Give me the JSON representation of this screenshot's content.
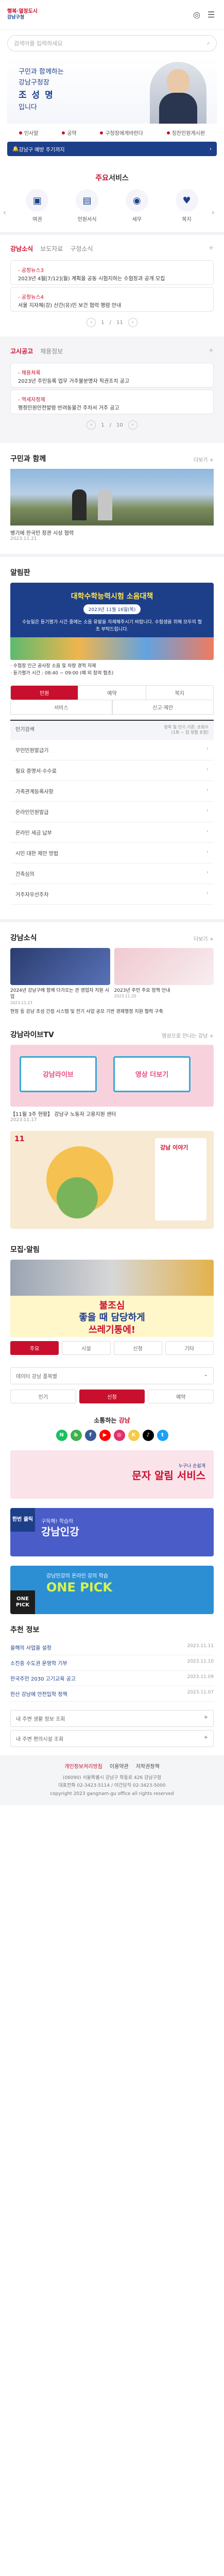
{
  "header": {
    "logo_line1": "행복·열정도시",
    "logo_line2": "강남구청",
    "menu_icon": "hamburger-icon",
    "lang_icon": "globe-icon"
  },
  "search": {
    "placeholder": "검색어를 입력하세요",
    "icon": "search-icon"
  },
  "hero": {
    "line1": "구민과 함께하는",
    "line2": "강남구청장",
    "name": "조 성 명",
    "line3": "입니다"
  },
  "hero_links": [
    "인사말",
    "공약",
    "구청장에게바란다",
    "칭찬민원게시판"
  ],
  "notice": {
    "label": "강남구 예방 주기까지",
    "arrow": "›"
  },
  "services": {
    "title_pre": "주요",
    "title_accent": "서비스",
    "items": [
      {
        "label": "여권"
      },
      {
        "label": "민원서식"
      },
      {
        "label": "세무"
      },
      {
        "label": "복지"
      }
    ]
  },
  "news": {
    "tabs": [
      "강남소식",
      "보도자료",
      "구정소식"
    ],
    "more": "+",
    "cards": [
      {
        "cat": "- 공정뉴스3",
        "title": "2023년 4월[7/12](월) 계획을 공동 시험지하는 수험장과 공개 모집",
        "date": "2023.11.27"
      },
      {
        "cat": "- 공정뉴스4",
        "title": "서울 지자체(강) 산간(유)민 보건 협력 행령 안내",
        "date": "2023.10.03"
      }
    ],
    "pager": {
      "current": "1",
      "total": "11"
    }
  },
  "notice_board": {
    "tabs": [
      "고시공고",
      "채용정보"
    ],
    "more": "+",
    "cards": [
      {
        "cat": "- 채용쳐록",
        "title": "2023년 주민등록 업무 거주불분명자 직권조치 공고",
        "date": "2023.11.07"
      },
      {
        "cat": "- 역세자정제",
        "title": "행정민원안전발령 반려동물건 주차서 거주 공고",
        "date": "2023.11.07"
      }
    ],
    "pager": {
      "current": "1",
      "total": "10"
    }
  },
  "mayor_with": {
    "title": "구민과 함께",
    "more": "더보기 +",
    "caption": "뱅기에 한국민 장관 시상 협력",
    "date": "2023.11.21"
  },
  "alert": {
    "title": "알림판",
    "banner_title": "대학수학능력시험 소음대책",
    "banner_date": "2023년 11월 16일(목)",
    "banner_body": "수능일은 듣기평가 시간 중에는 소음 유발을 자제해주시기 바랍니다. 수험생을 위해 모두의 협조 부탁드립니다.",
    "desc": "· 수험장 인근 공사장 소음 및 차량 경적 자제\n· 듣기평가 시간 : 08:40 ~ 09:00 (예 외 참여 협조)"
  },
  "popular": {
    "tabs": [
      "민원",
      "예약",
      "복지"
    ],
    "tabs2": [
      "서비스",
      "신고·제안"
    ],
    "head_label": "인기검색",
    "head_note": "항목 및 인기 기준: 조회수\n(1회 ~ 집 정렬 포함)",
    "rows": [
      {
        "label": "무인민원발급기",
        "arrow": "›"
      },
      {
        "label": "필요 증명서·수수료",
        "arrow": "›"
      },
      {
        "label": "가족관계등록사항",
        "arrow": "›"
      },
      {
        "label": "온라인민원발급",
        "arrow": "›"
      },
      {
        "label": "온라인 세금 납부",
        "arrow": "›"
      },
      {
        "label": "시민 대한 제안 방법",
        "arrow": "›"
      },
      {
        "label": "건축심의",
        "arrow": "›"
      },
      {
        "label": "거주자우선주차",
        "arrow": "›"
      }
    ]
  },
  "gangnam_news": {
    "title": "강남소식",
    "more": "더보기 +",
    "items": [
      {
        "title": "2024년 강남구에 함께 다가오는 관 영업자 지원 사업",
        "date": "2023.11.23"
      },
      {
        "title": "2023년 주민 주요 정책 안내",
        "date": "2023.11.20"
      }
    ],
    "extra": "현장 등 강남 조성 간접 시스템 및 전기 사업 공모 기반 경제행정 지원 협력 구축"
  },
  "tv": {
    "title": "강남라이브TV",
    "more": "영상으로 만나는 강남 +",
    "box_left": "강남라이브",
    "box_right": "영상 더보기",
    "desc": "【11월 3주 현황】 강남구 노동자 고용지원 센터",
    "date": "2023.11.17"
  },
  "poster": {
    "page": "11",
    "side": "강남 이야기"
  },
  "mojip": {
    "title": "모집·알림",
    "line1": "불조심",
    "line2": "좋을 때 담당하게",
    "line3": "쓰레기통에!"
  },
  "mojip_tabs": [
    "주요",
    "시설",
    "신청",
    "기타"
  ],
  "data_bar": {
    "title": "데이터 강남 품목별",
    "icon": "chevron-down-icon"
  },
  "small_tabs": [
    "인기",
    "신청",
    "예약"
  ],
  "sns": {
    "title_pre": "소통하는",
    "title_accent": "강남",
    "items": [
      {
        "t": "N",
        "c": "#19c15e"
      },
      {
        "t": "b",
        "c": "#3fb04c"
      },
      {
        "t": "f",
        "c": "#3b5998"
      },
      {
        "t": "▶",
        "c": "#ff0000"
      },
      {
        "t": "◎",
        "c": "#e1306c"
      },
      {
        "t": "K",
        "c": "#f7c948"
      },
      {
        "t": "♪",
        "c": "#000000"
      },
      {
        "t": "t",
        "c": "#1da1f2"
      }
    ]
  },
  "ad1": {
    "small": "누구나 손쉽게",
    "big": "문자 알림 서비스"
  },
  "ad2": {
    "title": "강남인강",
    "tag": "한번 클릭",
    "sub": "구독해! 학습하"
  },
  "ad3": {
    "title": "ONE PICK",
    "sub": "강남인강의 온라인 강의 학습",
    "tag": "ONE PICK"
  },
  "recommend": {
    "title": "추천 정보",
    "items": [
      {
        "label": "올해의 사업을 설정",
        "date": "2023.11.11"
      },
      {
        "label": "소진중 수도권 운영학 기부",
        "date": "2023.11.10"
      },
      {
        "label": "한국주민 2030 고기교육 공고",
        "date": "2023.11.09"
      },
      {
        "label": "한산 강남에 안전입학 정책",
        "date": "2023.11.07"
      }
    ]
  },
  "selects": [
    {
      "label": "내 주변 생활 정보 조회",
      "icon": "+"
    },
    {
      "label": "내 주변 편의시설 조회",
      "icon": "+"
    }
  ],
  "footer": {
    "links": [
      "개인정보처리방침",
      "이용약관",
      "저작권정책"
    ],
    "addr": "(06090) 서울특별시 강남구 학동로 426 강남구청",
    "tel": "대표전화 02-3423-5114 / 야간당직 02-3423-5000",
    "copy": "copyright 2023 gangnam-gu office all rights reserved"
  },
  "colors": {
    "brand_red": "#c8102e",
    "brand_blue": "#1d3f8a"
  }
}
